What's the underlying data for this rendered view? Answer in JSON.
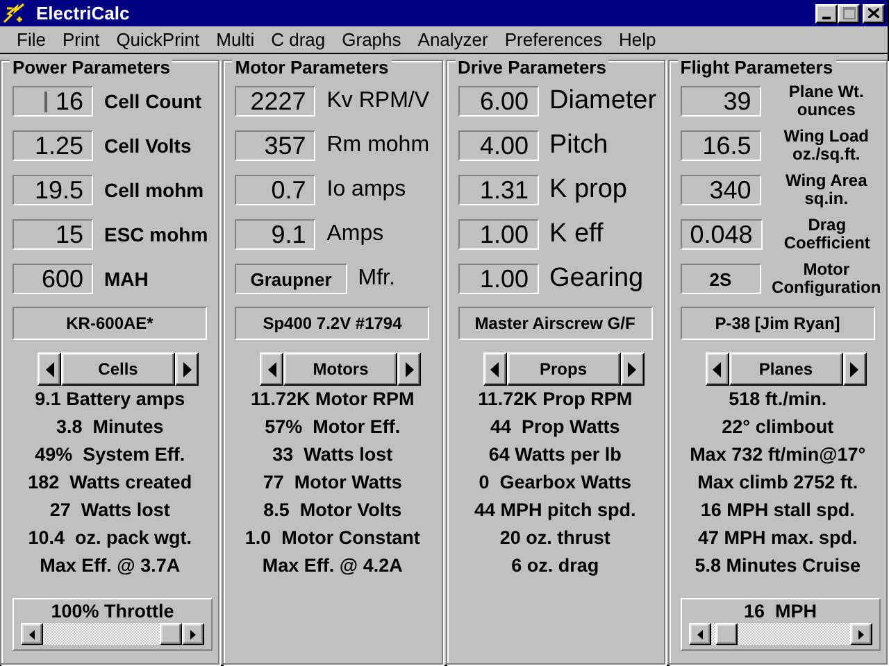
{
  "window": {
    "title": "ElectriCalc"
  },
  "menu": [
    "File",
    "Print",
    "QuickPrint",
    "Multi",
    "C drag",
    "Graphs",
    "Analyzer",
    "Preferences",
    "Help"
  ],
  "panels": [
    {
      "title": "Power Parameters",
      "kind": "power",
      "fields": [
        {
          "value": "16",
          "kind": "number",
          "label": [
            "Cell Count"
          ],
          "focused": true
        },
        {
          "value": "1.25",
          "kind": "number",
          "label": [
            "Cell Volts"
          ],
          "focused": false
        },
        {
          "value": "19.5",
          "kind": "number",
          "label": [
            "Cell mohm"
          ],
          "focused": false
        },
        {
          "value": "15",
          "kind": "number",
          "label": [
            "ESC mohm"
          ],
          "focused": false
        },
        {
          "value": "600",
          "kind": "number",
          "label": [
            "MAH"
          ],
          "focused": false
        }
      ],
      "selection": "KR-600AE*",
      "browser": "Cells",
      "results": [
        "9.1 Battery amps",
        "3.8  Minutes",
        "49%  System Eff.",
        "182  Watts created",
        "27  Watts lost",
        "10.4  oz. pack wgt.",
        "Max Eff. @ 3.7A"
      ],
      "slider": {
        "label": "100% Throttle",
        "level": 1
      }
    },
    {
      "title": "Motor Parameters",
      "kind": "motor",
      "fields": [
        {
          "value": "2227",
          "kind": "number",
          "label": [
            "Kv RPM/V"
          ],
          "focused": false
        },
        {
          "value": "357",
          "kind": "number",
          "label": [
            "Rm mohm"
          ],
          "focused": false
        },
        {
          "value": "0.7",
          "kind": "number",
          "label": [
            "Io  amps"
          ],
          "focused": false
        },
        {
          "value": "9.1",
          "kind": "number",
          "label": [
            "Amps"
          ],
          "focused": false
        },
        {
          "value": "Graupner",
          "kind": "name",
          "label": [
            "Mfr."
          ],
          "focused": false
        }
      ],
      "selection": "Sp400 7.2V #1794",
      "browser": "Motors",
      "results": [
        "11.72K Motor RPM",
        "57%  Motor Eff.",
        "33  Watts lost",
        "77  Motor Watts",
        "8.5  Motor Volts",
        "1.0  Motor Constant",
        "Max Eff. @ 4.2A"
      ]
    },
    {
      "title": "Drive Parameters",
      "kind": "drive",
      "fields": [
        {
          "value": "6.00",
          "kind": "number",
          "label": [
            "Diameter"
          ],
          "focused": false
        },
        {
          "value": "4.00",
          "kind": "number",
          "label": [
            "Pitch"
          ],
          "focused": false
        },
        {
          "value": "1.31",
          "kind": "number",
          "label": [
            "K  prop"
          ],
          "focused": false
        },
        {
          "value": "1.00",
          "kind": "number",
          "label": [
            "K  eff"
          ],
          "focused": false
        },
        {
          "value": "1.00",
          "kind": "number",
          "label": [
            "Gearing"
          ],
          "focused": false
        }
      ],
      "selection": "Master Airscrew G/F",
      "browser": "Props",
      "results": [
        "11.72K Prop RPM",
        "44  Prop Watts",
        "64 Watts per lb",
        "0  Gearbox Watts",
        "44 MPH pitch spd.",
        "20 oz. thrust",
        "6 oz. drag"
      ]
    },
    {
      "title": "Flight Parameters",
      "kind": "flight",
      "fields": [
        {
          "value": "39",
          "kind": "number",
          "label": [
            "Plane Wt.",
            "ounces"
          ],
          "focused": false
        },
        {
          "value": "16.5",
          "kind": "number",
          "label": [
            "Wing Load",
            "oz./sq.ft."
          ],
          "focused": false
        },
        {
          "value": "340",
          "kind": "number",
          "label": [
            "Wing Area",
            "sq.in."
          ],
          "focused": false
        },
        {
          "value": "0.048",
          "kind": "number",
          "label": [
            "Drag",
            "Coefficient"
          ],
          "focused": false
        },
        {
          "value": "2S",
          "kind": "name",
          "label": [
            "Motor",
            "Configuration"
          ],
          "focused": false
        }
      ],
      "selection": "P-38 [Jim Ryan]",
      "browser": "Planes",
      "results": [
        "518 ft./min.",
        "22° climbout",
        "Max 732 ft/min@17°",
        "Max climb 2752 ft.",
        "16 MPH stall spd.",
        "47 MPH max. spd.",
        "5.8 Minutes Cruise"
      ],
      "slider": {
        "label": "16  MPH",
        "level": 0.04
      }
    }
  ]
}
